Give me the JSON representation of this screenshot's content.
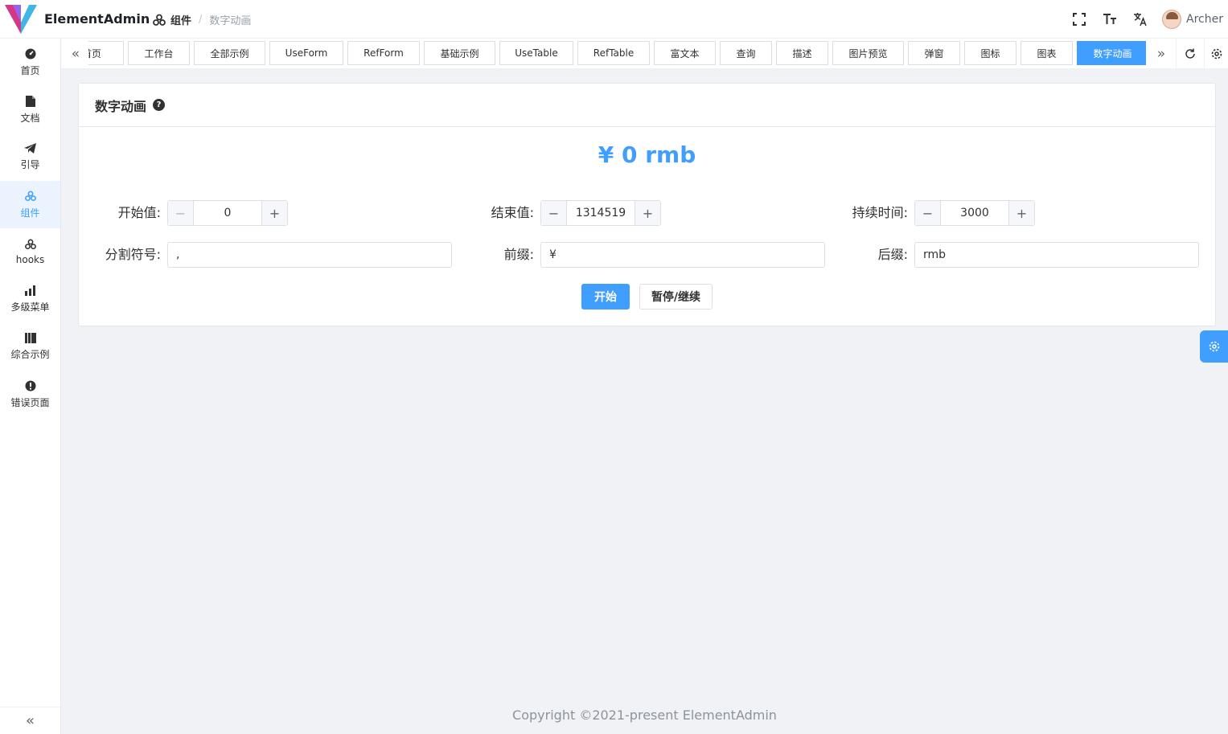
{
  "app": {
    "name": "ElementAdmin"
  },
  "breadcrumb": {
    "current": "组件",
    "separator": "/",
    "page": "数字动画"
  },
  "user": {
    "name": "Archer"
  },
  "header_tools": [
    "fullscreen-icon",
    "font-size-icon",
    "translate-icon"
  ],
  "sidebar": {
    "items": [
      {
        "label": "首页",
        "icon": "dashboard-icon"
      },
      {
        "label": "文档",
        "icon": "document-icon"
      },
      {
        "label": "引导",
        "icon": "send-icon"
      },
      {
        "label": "组件",
        "icon": "component-icon",
        "active": true
      },
      {
        "label": "hooks",
        "icon": "hooks-icon"
      },
      {
        "label": "多级菜单",
        "icon": "bar-chart-icon"
      },
      {
        "label": "综合示例",
        "icon": "book-icon"
      },
      {
        "label": "错误页面",
        "icon": "error-icon"
      }
    ],
    "collapse": "«"
  },
  "tags": {
    "prev": "«",
    "next": "»",
    "items": [
      {
        "label": "首页"
      },
      {
        "label": "工作台"
      },
      {
        "label": "全部示例"
      },
      {
        "label": "UseForm"
      },
      {
        "label": "RefForm"
      },
      {
        "label": "基础示例"
      },
      {
        "label": "UseTable"
      },
      {
        "label": "RefTable"
      },
      {
        "label": "富文本"
      },
      {
        "label": "查询"
      },
      {
        "label": "描述"
      },
      {
        "label": "图片预览"
      },
      {
        "label": "弹窗"
      },
      {
        "label": "图标"
      },
      {
        "label": "图表"
      },
      {
        "label": "数字动画",
        "active": true
      }
    ]
  },
  "card": {
    "title": "数字动画",
    "help": "?",
    "display": "¥ 0 rmb",
    "fields": {
      "start": {
        "label": "开始值:",
        "value": "0"
      },
      "end": {
        "label": "结束值:",
        "value": "1314519"
      },
      "duration": {
        "label": "持续时间:",
        "value": "3000"
      },
      "separator": {
        "label": "分割符号:",
        "value": ","
      },
      "prefix": {
        "label": "前缀:",
        "value": "¥"
      },
      "suffix": {
        "label": "后缀:",
        "value": "rmb"
      }
    },
    "stepper": {
      "minus": "−",
      "plus": "+"
    },
    "buttons": {
      "start": "开始",
      "pause": "暂停/继续"
    }
  },
  "footer": {
    "copyright": "Copyright ©2021-present ElementAdmin"
  },
  "colors": {
    "primary": "#409eff",
    "background": "#f0f2f5"
  }
}
